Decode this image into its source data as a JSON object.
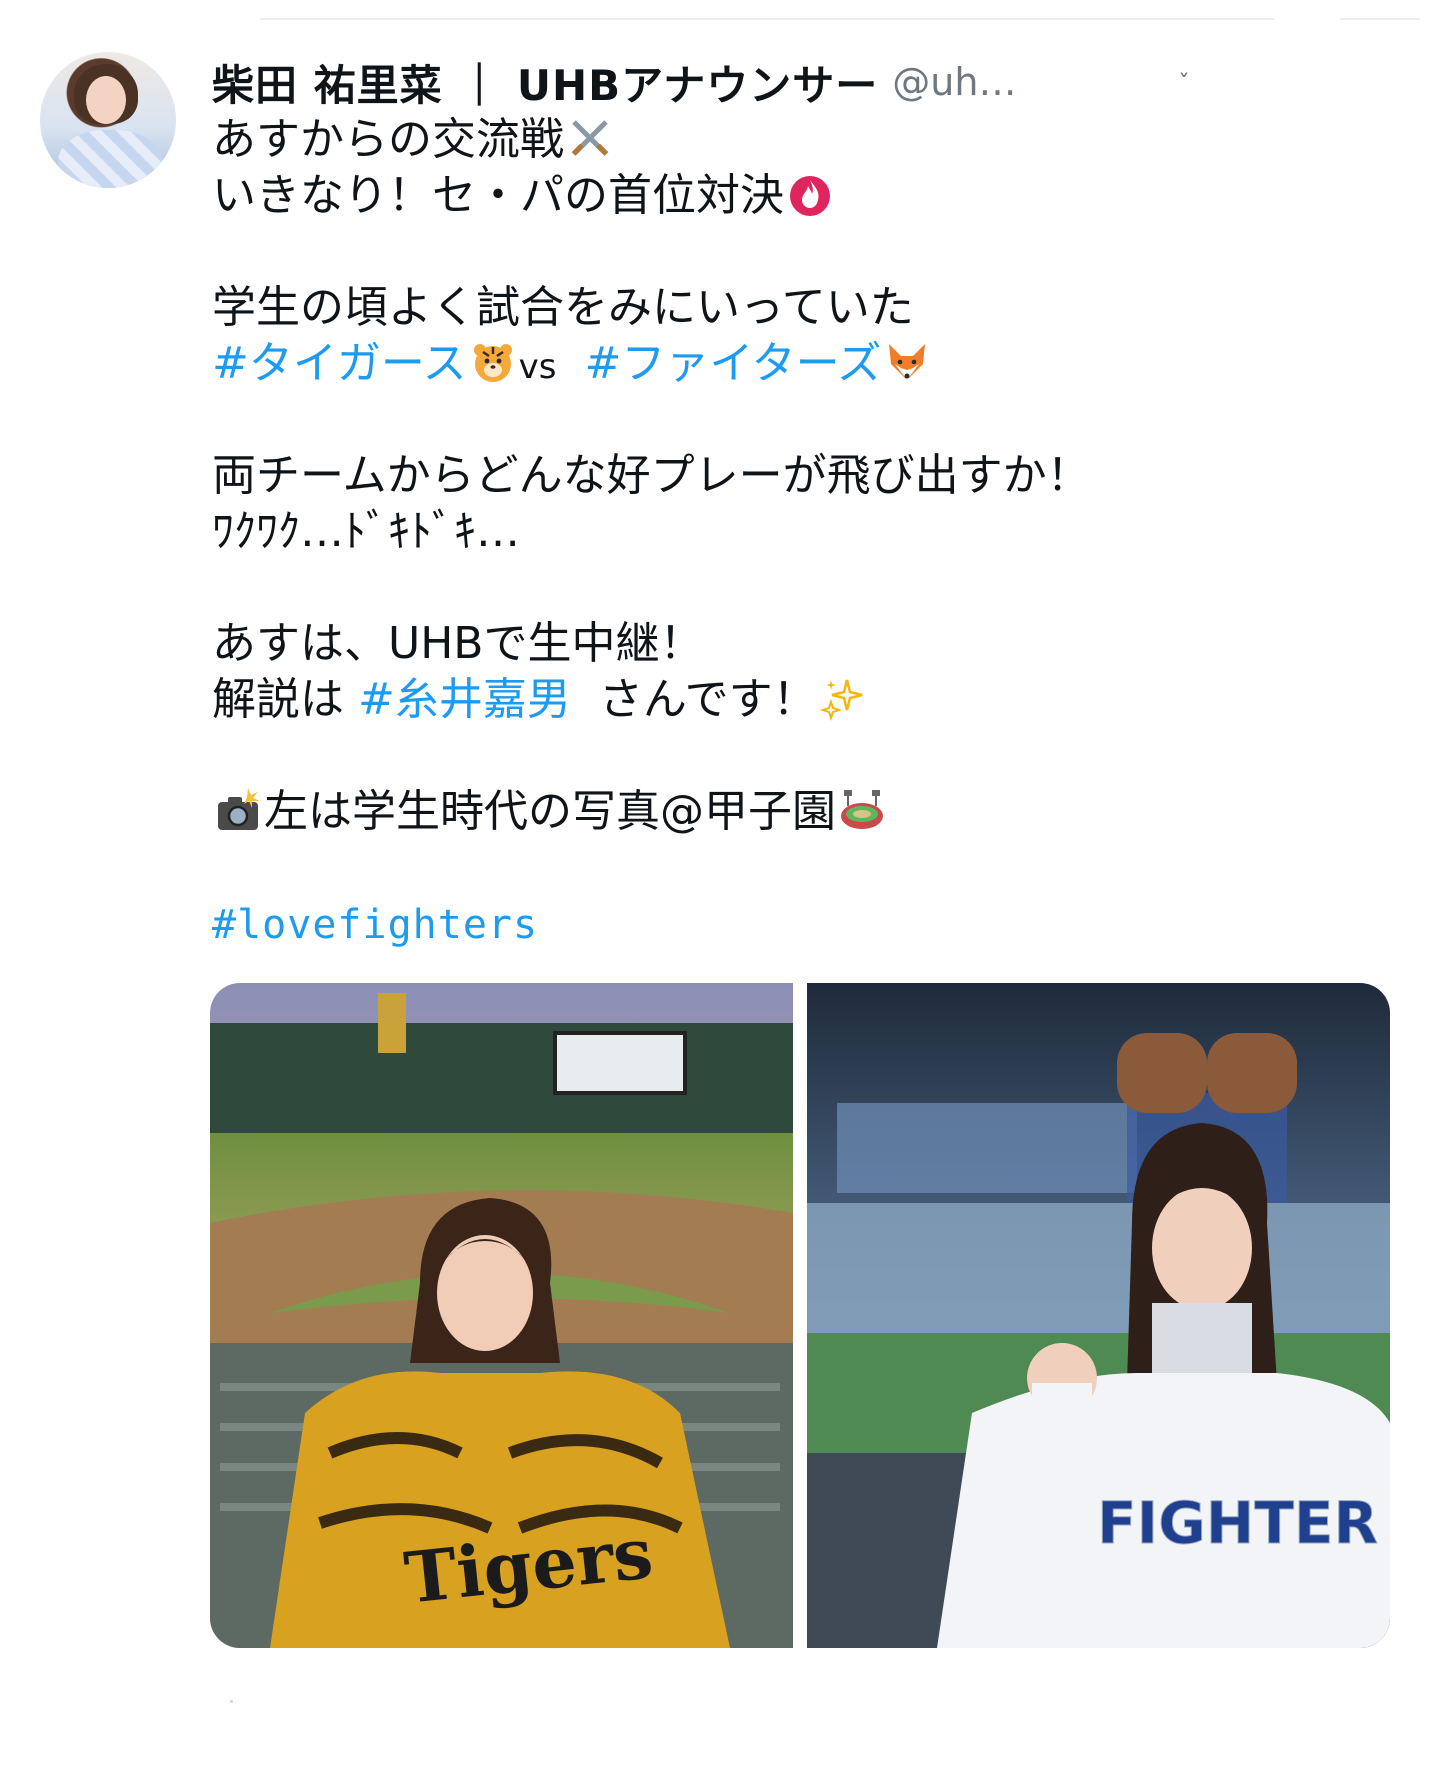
{
  "tweet": {
    "author": {
      "display_name": "柴田 祐里菜 ｜ UHBアナウンサー",
      "handle": "@uh…",
      "avatar_icon": "user-avatar"
    },
    "more_caret": "ˇ",
    "lines": [
      "あすからの交流戦",
      "いきなり！セ・パの首位対決",
      "学生の頃よく試合をみにいっていた",
      "#タイガース",
      "vs",
      "#ファイターズ",
      "両チームからどんな好プレーが飛び出すか！",
      "ﾜｸﾜｸ…ﾄﾞｷﾄﾞｷ…",
      "あすは、UHBで生中継！",
      "解説は",
      "#糸井嘉男",
      "さんです！",
      "左は学生時代の写真@甲子園",
      "#lovefighters"
    ],
    "emojis": {
      "swords": "crossed-swords-icon",
      "fire": "fire-icon",
      "tiger": "tiger-face-icon",
      "fox": "fox-face-icon",
      "sparkles": "sparkles-icon",
      "camera": "camera-flash-icon",
      "stadium": "stadium-icon"
    },
    "media": {
      "photo_left_jersey_text": "Tigers",
      "photo_right_jersey_text": "FIGHTER"
    },
    "colors": {
      "hashtag": "#1d9bf0",
      "text": "#0f1419",
      "secondary": "#6e7881"
    }
  }
}
